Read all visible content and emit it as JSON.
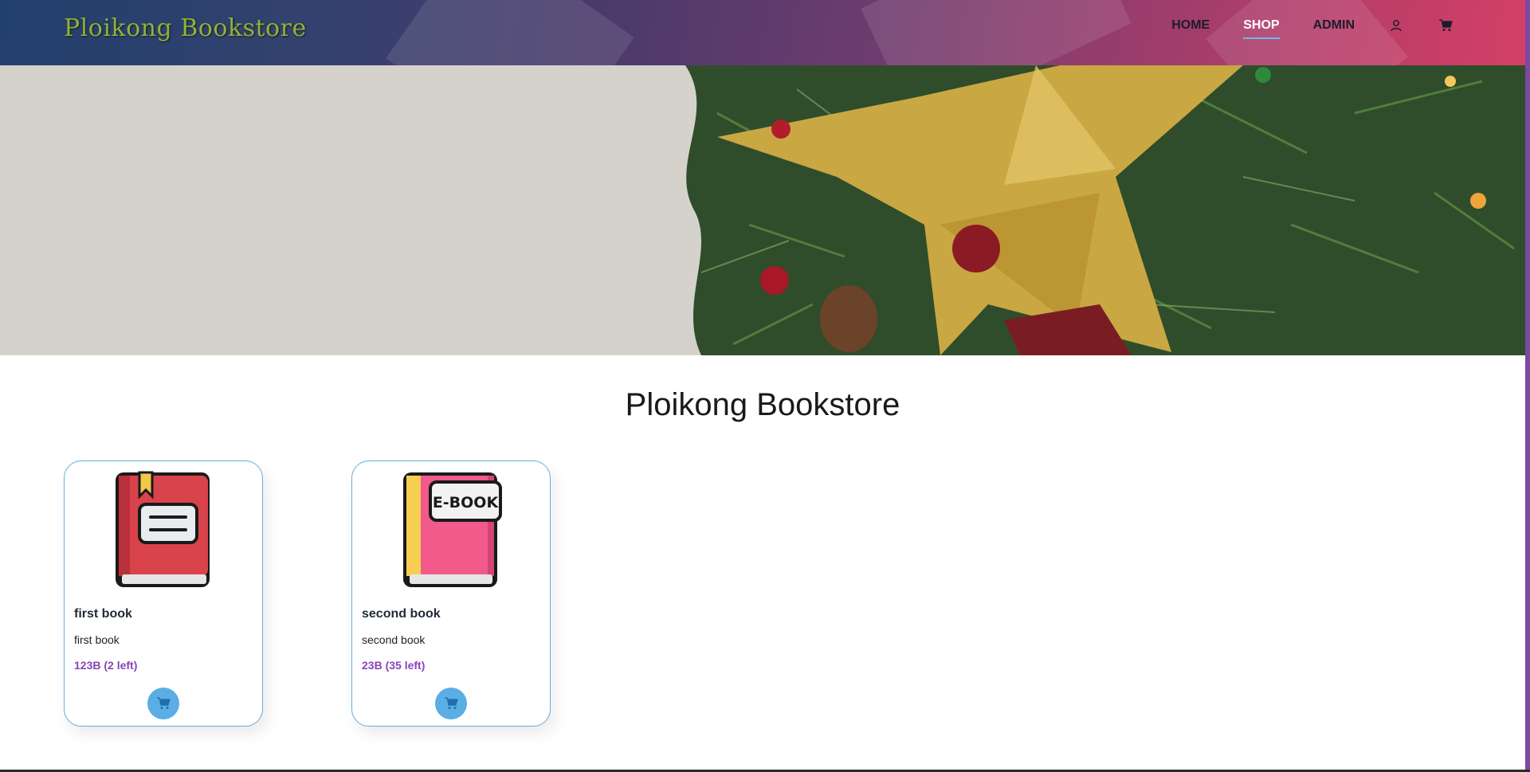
{
  "navbar": {
    "brand": "Ploikong Bookstore",
    "links": [
      {
        "label": "HOME",
        "active": false
      },
      {
        "label": "SHOP",
        "active": true
      },
      {
        "label": "ADMIN",
        "active": false
      }
    ],
    "icons": [
      "user-icon",
      "cart-icon"
    ]
  },
  "hero": {
    "description_icon": "christmas-tree-banner-image"
  },
  "main": {
    "title": "Ploikong Bookstore"
  },
  "books": [
    {
      "name": "first book",
      "description": "first book",
      "price": "123B (2 left)",
      "cover_icon": "red-book-icon",
      "cart_icon": "cart-icon"
    },
    {
      "name": "second book",
      "description": "second book",
      "price": "23B (35 left)",
      "cover_icon": "ebook-icon",
      "cover_label": "E-BOOK",
      "cart_icon": "cart-icon"
    }
  ],
  "colors": {
    "accent_blue": "#5aaee4",
    "price_purple": "#8a44b8",
    "brand_green": "#8fb23a"
  }
}
